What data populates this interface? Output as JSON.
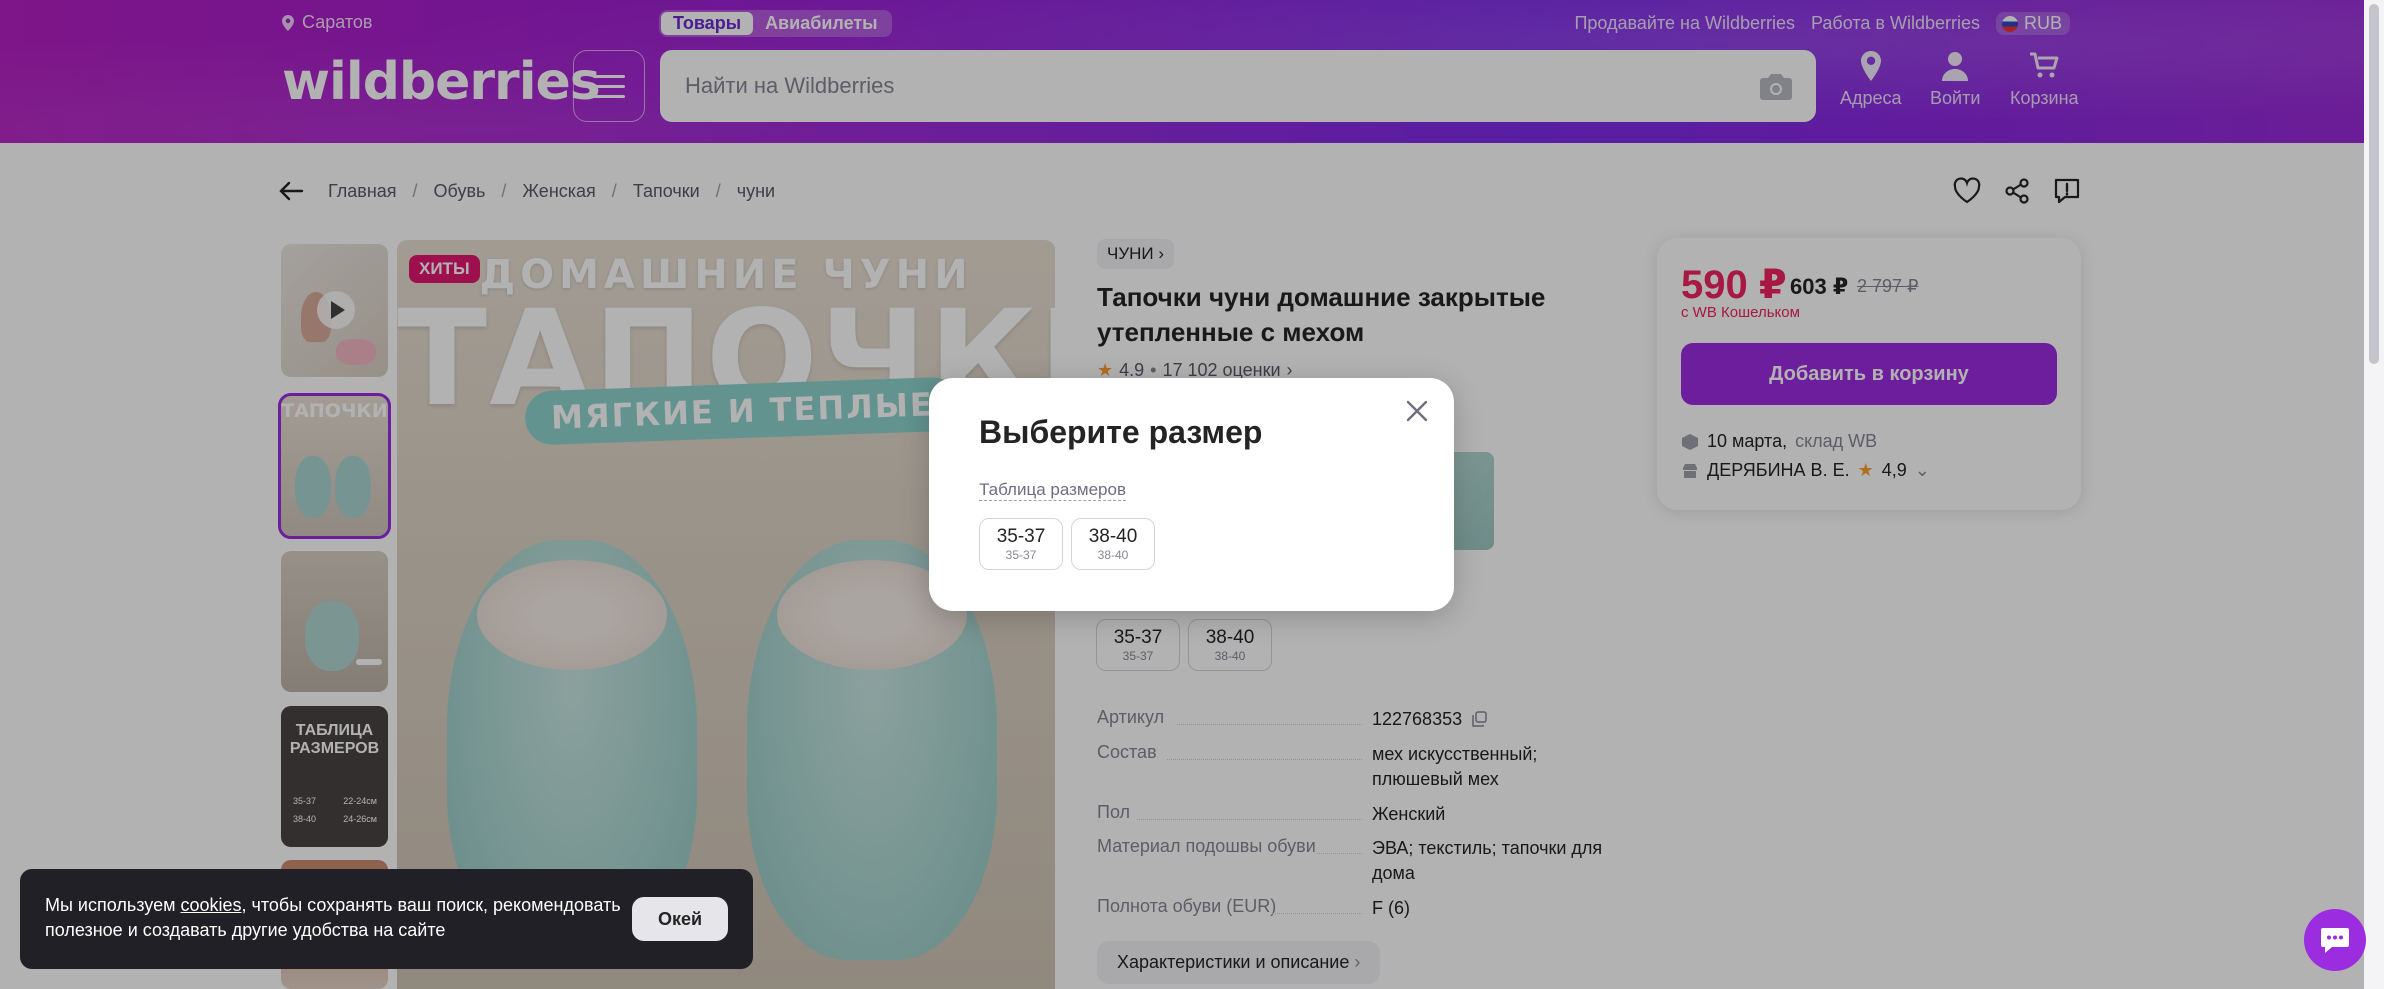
{
  "header": {
    "city": "Саратов",
    "tabs": [
      "Товары",
      "Авиабилеты"
    ],
    "top_links": [
      "Продавайте на Wildberries",
      "Работа в Wildberries"
    ],
    "currency": "RUB",
    "logo": "wildberries",
    "search_placeholder": "Найти на Wildberries",
    "nav": {
      "addresses": "Адреса",
      "login": "Войти",
      "cart": "Корзина"
    }
  },
  "breadcrumbs": [
    "Главная",
    "Обувь",
    "Женская",
    "Тапочки",
    "чуни"
  ],
  "gallery": {
    "badge": "ХИТЫ",
    "headline_small": "ДОМАШНИЕ ЧУНИ",
    "headline_big": "ТАПОЧКИ",
    "headline_pill": "МЯГКИЕ И ТЕПЛЫЕ",
    "thumb_texts": {
      "thumb2_title": "ТАПОЧКИ",
      "thumb4_title_1": "ТАБЛИЦА",
      "thumb4_title_2": "РАЗМЕРОВ",
      "thumb4_rows": [
        [
          "35-37",
          "22-24см"
        ],
        [
          "38-40",
          "24-26см"
        ]
      ]
    }
  },
  "product": {
    "brand": "ЧУНИ",
    "title": "Тапочки чуни домашние закрытые утепленные с мехом",
    "rating": "4.9",
    "reviews": "17 102 оценки",
    "sizes": [
      {
        "label": "35-37",
        "sub": "35-37"
      },
      {
        "label": "38-40",
        "sub": "38-40"
      }
    ],
    "specs": [
      {
        "key": "Артикул",
        "value": "122768353"
      },
      {
        "key": "Состав",
        "value": "мех искусственный; плюшевый мех"
      },
      {
        "key": "Пол",
        "value": "Женский"
      },
      {
        "key": "Материал подошвы обуви",
        "value": "ЭВА; текстиль; тапочки для дома"
      },
      {
        "key": "Полнота обуви (EUR)",
        "value": "F (6)"
      }
    ],
    "characteristics_button": "Характеристики и описание"
  },
  "price_card": {
    "price": "590 ₽",
    "price_no_wallet": "603 ₽",
    "old_price": "2 797 ₽",
    "wallet_note": "с WB Кошельком",
    "add_to_cart": "Добавить в корзину",
    "delivery_date": "10 марта,",
    "delivery_source": "склад WB",
    "seller": "ДЕРЯБИНА В. Е.",
    "seller_rating": "4,9"
  },
  "modal": {
    "title": "Выберите размер",
    "size_table_link": "Таблица размеров",
    "sizes": [
      {
        "label": "35-37",
        "sub": "35-37"
      },
      {
        "label": "38-40",
        "sub": "38-40"
      }
    ]
  },
  "cookie": {
    "text_before": "Мы используем ",
    "link": "cookies",
    "text_after": ", чтобы сохранять ваш поиск, рекомендовать полезное и создавать другие удобства на сайте",
    "ok": "Окей"
  },
  "colors": {
    "accent": "#9b2ce0",
    "price": "#f0245f",
    "badge": "#e3186f"
  }
}
